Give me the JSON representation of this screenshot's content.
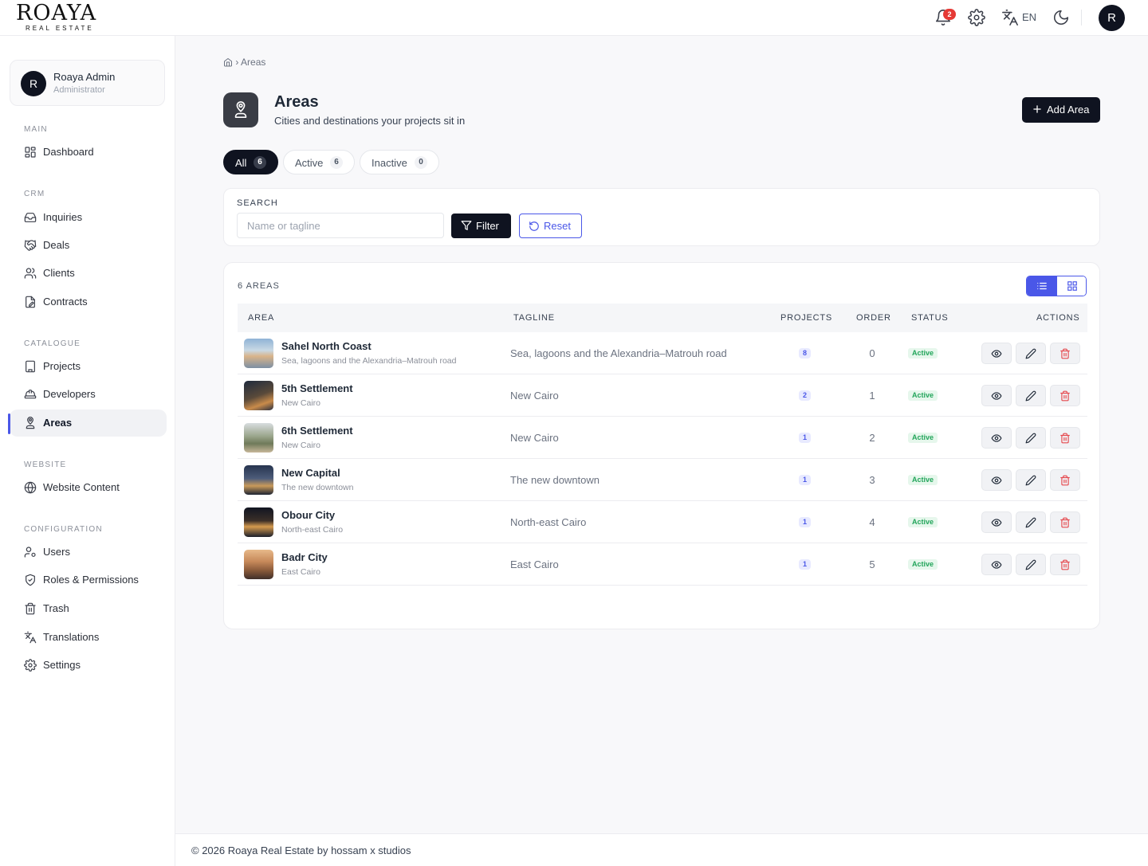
{
  "brand": {
    "name": "ROAYA",
    "sub": "REAL ESTATE"
  },
  "topbar": {
    "notification_count": "2",
    "language": "EN",
    "avatar_initial": "R"
  },
  "profile": {
    "initial": "R",
    "name": "Roaya Admin",
    "role": "Administrator"
  },
  "sidebar": {
    "sections": [
      {
        "title": "MAIN",
        "items": [
          {
            "label": "Dashboard",
            "icon": "dashboard-icon"
          }
        ]
      },
      {
        "title": "CRM",
        "items": [
          {
            "label": "Inquiries",
            "icon": "inbox-icon"
          },
          {
            "label": "Deals",
            "icon": "handshake-icon"
          },
          {
            "label": "Clients",
            "icon": "users-icon"
          },
          {
            "label": "Contracts",
            "icon": "contract-icon"
          }
        ]
      },
      {
        "title": "CATALOGUE",
        "items": [
          {
            "label": "Projects",
            "icon": "building-icon"
          },
          {
            "label": "Developers",
            "icon": "crane-icon"
          },
          {
            "label": "Areas",
            "icon": "map-pin-user-icon",
            "active": true
          }
        ]
      },
      {
        "title": "WEBSITE",
        "items": [
          {
            "label": "Website Content",
            "icon": "globe-icon"
          }
        ]
      },
      {
        "title": "CONFIGURATION",
        "items": [
          {
            "label": "Users",
            "icon": "user-cog-icon"
          },
          {
            "label": "Roles & Permissions",
            "icon": "shield-check-icon"
          },
          {
            "label": "Trash",
            "icon": "trash-icon"
          },
          {
            "label": "Translations",
            "icon": "translate-icon"
          },
          {
            "label": "Settings",
            "icon": "gear-icon"
          }
        ]
      }
    ]
  },
  "breadcrumb": {
    "current": "Areas"
  },
  "page": {
    "title": "Areas",
    "subtitle": "Cities and destinations your projects sit in",
    "add_button": "Add Area"
  },
  "tabs": [
    {
      "label": "All",
      "count": "6",
      "active": true
    },
    {
      "label": "Active",
      "count": "6"
    },
    {
      "label": "Inactive",
      "count": "0"
    }
  ],
  "search": {
    "label": "SEARCH",
    "placeholder": "Name or tagline",
    "value": "",
    "filter_button": "Filter",
    "reset_button": "Reset"
  },
  "table": {
    "count_label": "6 AREAS",
    "columns": {
      "area": "AREA",
      "tagline": "TAGLINE",
      "projects": "PROJECTS",
      "order": "ORDER",
      "status": "STATUS",
      "actions": "ACTIONS"
    },
    "rows": [
      {
        "name": "Sahel North Coast",
        "tagline": "Sea, lagoons and the Alexandria–Matrouh road",
        "projects": "8",
        "order": "0",
        "status": "Active"
      },
      {
        "name": "5th Settlement",
        "tagline": "New Cairo",
        "projects": "2",
        "order": "1",
        "status": "Active"
      },
      {
        "name": "6th Settlement",
        "tagline": "New Cairo",
        "projects": "1",
        "order": "2",
        "status": "Active"
      },
      {
        "name": "New Capital",
        "tagline": "The new downtown",
        "projects": "1",
        "order": "3",
        "status": "Active"
      },
      {
        "name": "Obour City",
        "tagline": "North-east Cairo",
        "projects": "1",
        "order": "4",
        "status": "Active"
      },
      {
        "name": "Badr City",
        "tagline": "East Cairo",
        "projects": "1",
        "order": "5",
        "status": "Active"
      }
    ]
  },
  "footer": {
    "text": "© 2026 Roaya Real Estate by hossam x studios"
  },
  "colors": {
    "accent": "#4a57e8",
    "dark": "#0f1320",
    "success": "#22a55a",
    "danger": "#e5484d"
  }
}
